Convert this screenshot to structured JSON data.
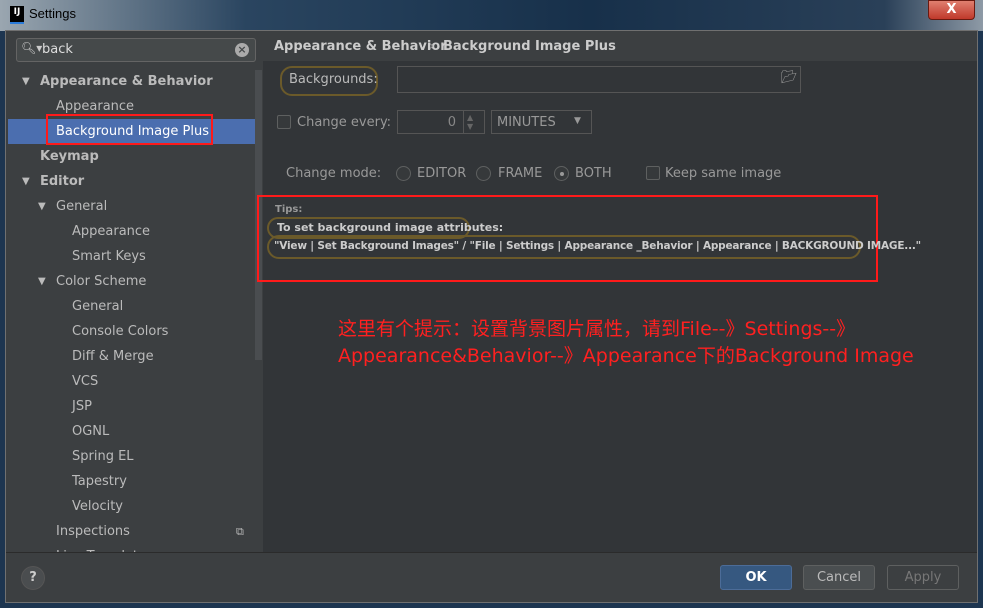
{
  "window": {
    "title": "Settings",
    "app_icon": "IJ",
    "close": "X"
  },
  "search": {
    "value": "back"
  },
  "tree": [
    {
      "label": "Appearance & Behavior",
      "level": 0,
      "bold": true,
      "arrow": "▼"
    },
    {
      "label": "Appearance",
      "level": 1
    },
    {
      "label": "Background Image Plus",
      "level": 1,
      "selected": true
    },
    {
      "label": "Keymap",
      "level": 0,
      "bold": true
    },
    {
      "label": "Editor",
      "level": 0,
      "bold": true,
      "arrow": "▼"
    },
    {
      "label": "General",
      "level": 1,
      "arrow": "▼"
    },
    {
      "label": "Appearance",
      "level": 2
    },
    {
      "label": "Smart Keys",
      "level": 2
    },
    {
      "label": "Color Scheme",
      "level": 1,
      "arrow": "▼"
    },
    {
      "label": "General",
      "level": 2
    },
    {
      "label": "Console Colors",
      "level": 2
    },
    {
      "label": "Diff & Merge",
      "level": 2
    },
    {
      "label": "VCS",
      "level": 2
    },
    {
      "label": "JSP",
      "level": 2
    },
    {
      "label": "OGNL",
      "level": 2
    },
    {
      "label": "Spring EL",
      "level": 2
    },
    {
      "label": "Tapestry",
      "level": 2
    },
    {
      "label": "Velocity",
      "level": 2
    },
    {
      "label": "Inspections",
      "level": 1,
      "badge": "copy-icon"
    },
    {
      "label": "Live Templates",
      "level": 1
    }
  ],
  "breadcrumb": {
    "parent": "Appearance & Behavior",
    "sep": "›",
    "current": "Background Image Plus"
  },
  "form": {
    "backgrounds_label": "Backgrounds:",
    "backgrounds_value": "",
    "change_every_label": "Change every:",
    "change_every_value": "0",
    "unit": "MINUTES",
    "change_mode_label": "Change mode:",
    "modes": [
      "EDITOR",
      "FRAME",
      "BOTH"
    ],
    "selected_mode": "BOTH",
    "keep_same_label": "Keep same image"
  },
  "tips": {
    "title": "Tips:",
    "heading": "To set background image attributes:",
    "text": "\"View | Set Background Images\" / \"File | Settings | Appearance _Behavior | Appearance | BACKGROUND IMAGE...\""
  },
  "annotation": {
    "line1": "这里有个提示：设置背景图片属性，请到File--》Settings--》",
    "line2": "Appearance&Behavior--》Appearance下的Background Image",
    "color": "#ff2020"
  },
  "footer": {
    "help": "?",
    "ok": "OK",
    "cancel": "Cancel",
    "apply": "Apply"
  },
  "colors": {
    "accent": "#4b6eaf",
    "ok_button": "#365880"
  }
}
